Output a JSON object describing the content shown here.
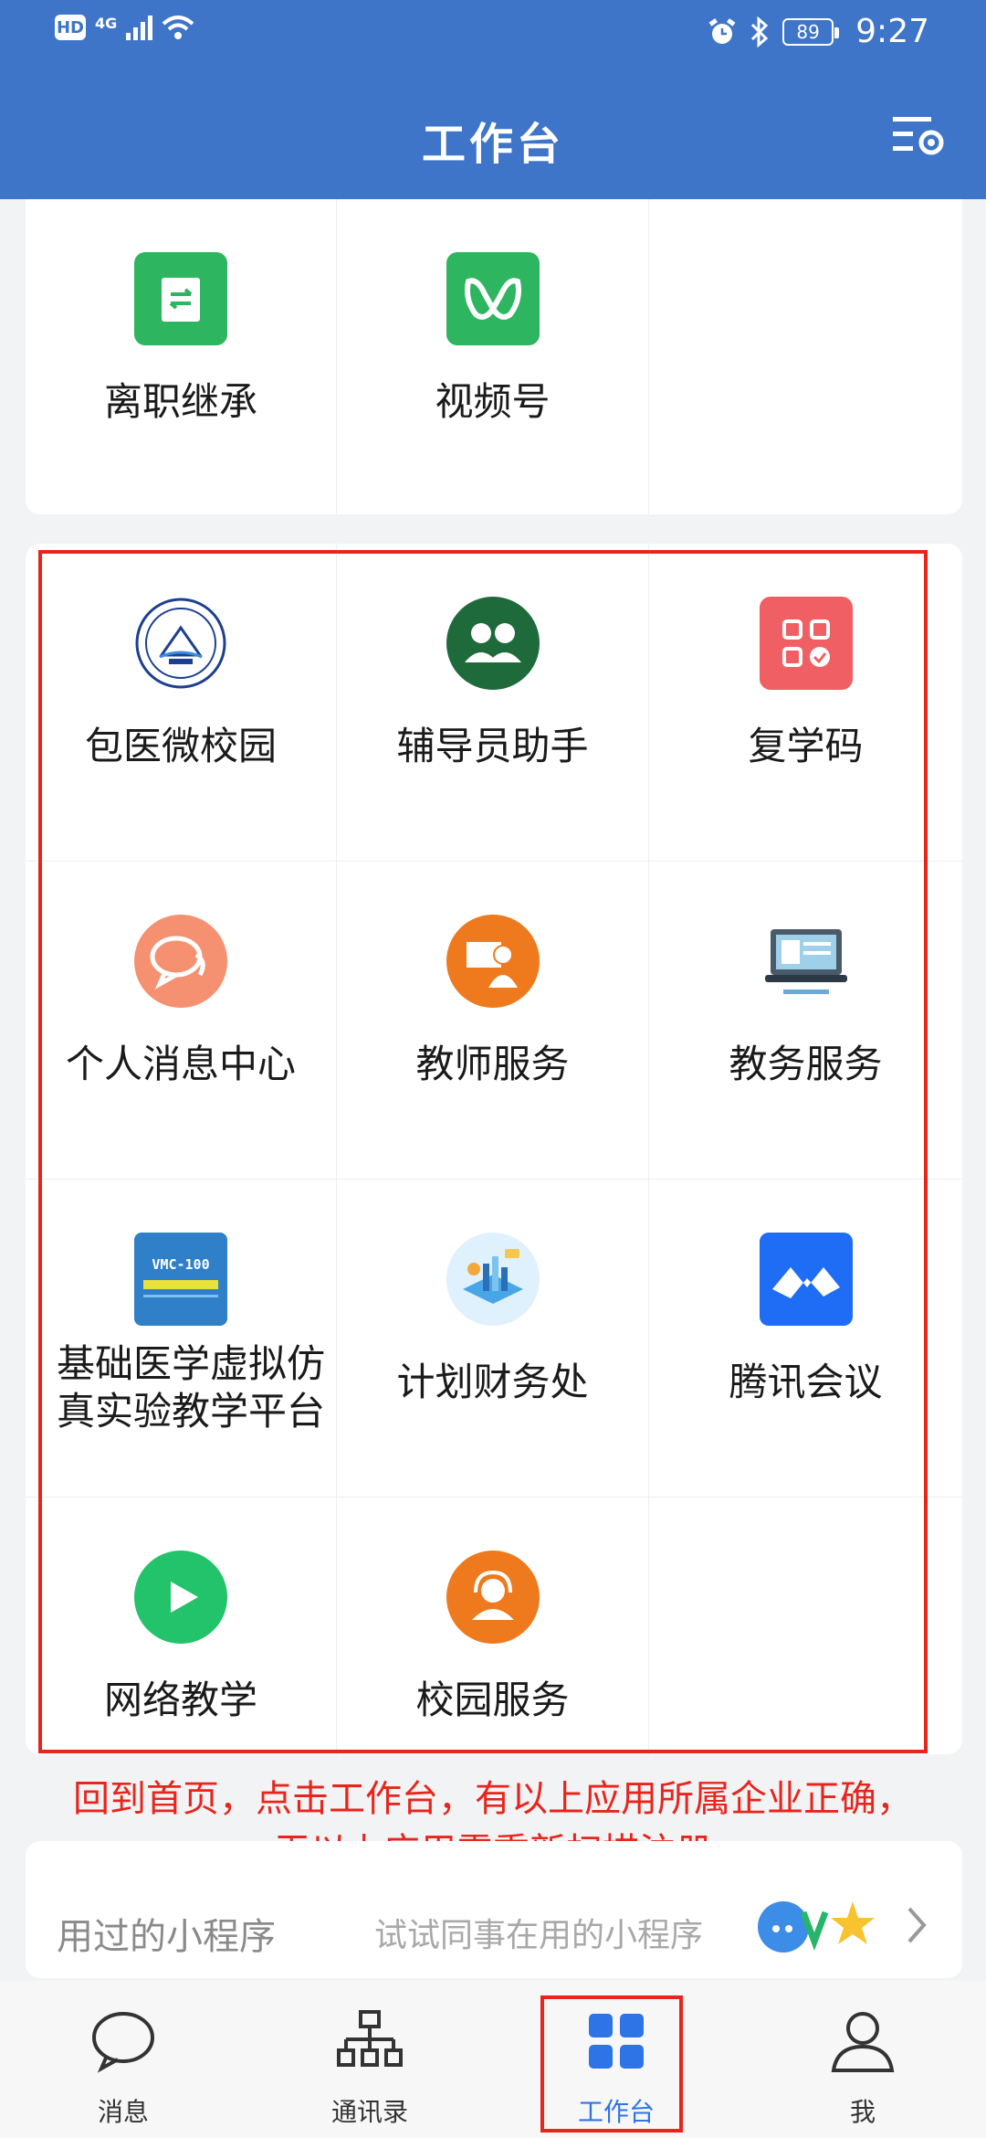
{
  "status_bar": {
    "hd": "HD",
    "network": "4G",
    "battery": "89",
    "time": "9:27"
  },
  "header": {
    "title": "工作台",
    "manage_icon": "settings-list-icon"
  },
  "card_top": {
    "apps": [
      {
        "label": "离职继承",
        "icon": "handover-icon",
        "color": "#2db560"
      },
      {
        "label": "视频号",
        "icon": "channels-icon",
        "color": "#2db560"
      },
      {
        "label": "",
        "icon": ""
      }
    ]
  },
  "card_apps": {
    "apps": [
      {
        "label": "包医微校园",
        "icon": "university-seal-icon"
      },
      {
        "label": "辅导员助手",
        "icon": "counselor-icon",
        "color": "#1e6a3b"
      },
      {
        "label": "复学码",
        "icon": "qr-code-check-icon",
        "color": "#f05f63"
      },
      {
        "label": "个人消息中心",
        "icon": "chat-bubbles-icon",
        "color": "#f59171"
      },
      {
        "label": "教师服务",
        "icon": "teacher-icon",
        "color": "#ef7a1d"
      },
      {
        "label": "教务服务",
        "icon": "academic-system-icon",
        "color": "#4a5a6a"
      },
      {
        "label": "基础医学虚拟仿真实验教学平台",
        "icon": "vmc-icon",
        "color": "#2f80c9",
        "badge": "VMC-100"
      },
      {
        "label": "计划财务处",
        "icon": "finance-icon",
        "color": "#49a6e6"
      },
      {
        "label": "腾讯会议",
        "icon": "tencent-meeting-icon",
        "color": "#1f6df5"
      },
      {
        "label": "网络教学",
        "icon": "play-icon",
        "color": "#22c36b"
      },
      {
        "label": "校园服务",
        "icon": "headset-service-icon",
        "color": "#ef7a1d"
      },
      {
        "label": "",
        "icon": ""
      }
    ]
  },
  "annotation": {
    "line1": "回到首页，点击工作台，有以上应用所属企业正确，",
    "line2": "无以上应用需重新扫描注册"
  },
  "mini_programs": {
    "used": "用过的小程序",
    "try": "试试同事在用的小程序"
  },
  "bottom_nav": {
    "items": [
      {
        "label": "消息",
        "icon": "message-icon"
      },
      {
        "label": "通讯录",
        "icon": "contacts-tree-icon"
      },
      {
        "label": "工作台",
        "icon": "workbench-grid-icon",
        "active": true
      },
      {
        "label": "我",
        "icon": "profile-icon"
      }
    ]
  },
  "colors": {
    "header": "#3f75c8",
    "accent": "#2f74e6",
    "annotation": "#e8251c"
  }
}
